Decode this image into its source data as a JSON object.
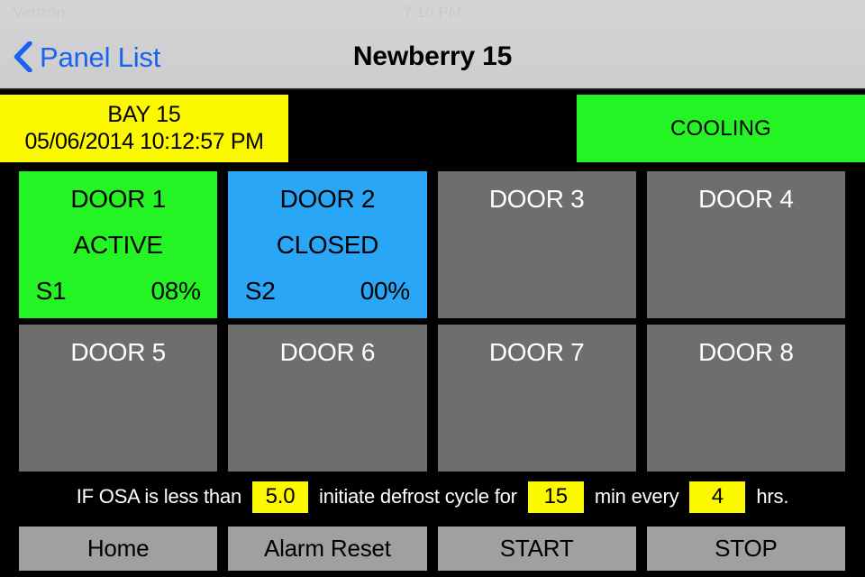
{
  "statusbar": {
    "carrier": "Verizon",
    "time": "7:10 PM",
    "battery": ""
  },
  "navbar": {
    "back_label": "Panel List",
    "back_icon": "chevron-left-icon",
    "title": "Newberry 15"
  },
  "banner": {
    "bay_title": "BAY 15",
    "bay_datetime": "05/06/2014 10:12:57 PM",
    "bay_color": "#fcf800",
    "mode_label": "COOLING",
    "mode_color": "#25f424"
  },
  "doors": [
    {
      "title": "DOOR 1",
      "status": "ACTIVE",
      "sensor": "S1",
      "value": "08%",
      "state": "active",
      "color": "#25f424"
    },
    {
      "title": "DOOR 2",
      "status": "CLOSED",
      "sensor": "S2",
      "value": "00%",
      "state": "closed",
      "color": "#29a6f5"
    },
    {
      "title": "DOOR 3",
      "status": "",
      "sensor": "",
      "value": "",
      "state": "inactive",
      "color": "#6e6e6e"
    },
    {
      "title": "DOOR 4",
      "status": "",
      "sensor": "",
      "value": "",
      "state": "inactive",
      "color": "#6e6e6e"
    },
    {
      "title": "DOOR 5",
      "status": "",
      "sensor": "",
      "value": "",
      "state": "inactive",
      "color": "#6e6e6e"
    },
    {
      "title": "DOOR 6",
      "status": "",
      "sensor": "",
      "value": "",
      "state": "inactive",
      "color": "#6e6e6e"
    },
    {
      "title": "DOOR 7",
      "status": "",
      "sensor": "",
      "value": "",
      "state": "inactive",
      "color": "#6e6e6e"
    },
    {
      "title": "DOOR 8",
      "status": "",
      "sensor": "",
      "value": "",
      "state": "inactive",
      "color": "#6e6e6e"
    }
  ],
  "defrost": {
    "text_1": "IF OSA is less than",
    "osa_threshold": "5.0",
    "text_2": "initiate defrost cycle for",
    "cycle_minutes": "15",
    "text_3": "min every",
    "interval_hours": "4",
    "text_4": "hrs."
  },
  "buttons": [
    {
      "label": "Home"
    },
    {
      "label": "Alarm Reset"
    },
    {
      "label": "START"
    },
    {
      "label": "STOP"
    }
  ]
}
